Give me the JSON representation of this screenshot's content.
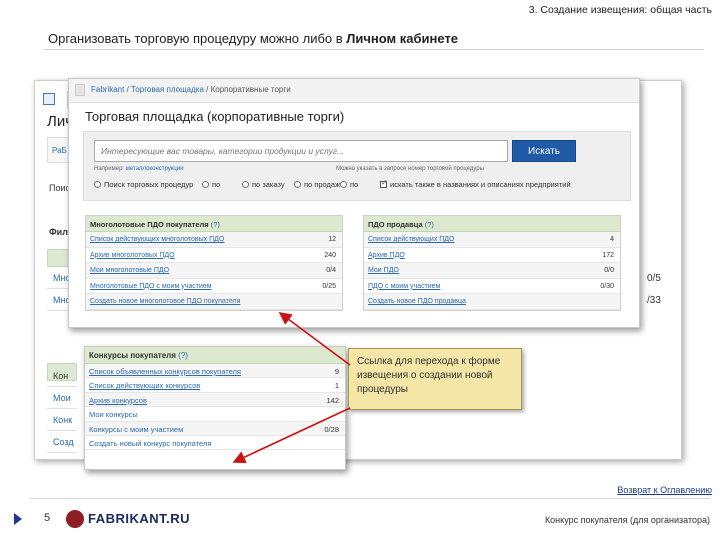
{
  "section_label": "3. Создание извещения: общая часть",
  "heading": {
    "prefix": "Организовать торговую процедуру можно либо в ",
    "bold": "Личном кабинете"
  },
  "bg_page": {
    "title": "Лич",
    "tab": "РаБ",
    "text1": "Поиско",
    "text2": "Филь",
    "rows": [
      "Мно",
      "Мно"
    ],
    "row_labels2": [
      "Кон",
      "Мои",
      "Конк",
      "Созд"
    ],
    "right_vals": [
      "0/5",
      "/33"
    ]
  },
  "window": {
    "breadcrumb": {
      "items": [
        "Fabrikant",
        "Торговая площадка",
        "Корпоративные торги"
      ],
      "separator": " / "
    },
    "title": "Торговая площадка (корпоративные торги)",
    "search": {
      "placeholder": "Интересующие вас товары, категории продукции и услуг...",
      "button": "Искать",
      "hint_left_prefix": "Например: ",
      "hint_left_link": "металлоконструкции",
      "hint_right": "Можно указать в запросе номер торговой процедуры",
      "options": [
        {
          "label": "Поиск торговых процедур",
          "type": "radio"
        },
        {
          "label": "по",
          "type": "radio"
        },
        {
          "label": "по заказу",
          "type": "radio"
        },
        {
          "label": "по продаже",
          "type": "radio"
        },
        {
          "label": "по",
          "type": "radio"
        },
        {
          "label": "искать также в названиях и описаниях предприятий",
          "type": "check"
        }
      ]
    },
    "panel_left": {
      "title": "Многолотовые ПДО покупателя",
      "help": "(?)",
      "rows": [
        {
          "label": "Список действующих многолотовых ПДО",
          "value": "12"
        },
        {
          "label": "Архив многолотовых ПДО",
          "value": "240"
        },
        {
          "label": "Мои многолотовые ПДО",
          "value": "0/4"
        },
        {
          "label": "Многолотовые ПДО с моим участием",
          "value": "0/25"
        },
        {
          "label": "Создать новое многолотовое ПДО покупателя",
          "value": ""
        }
      ]
    },
    "panel_right": {
      "title": "ПДО продавца",
      "help": "(?)",
      "rows": [
        {
          "label": "Список действующих ПДО",
          "value": "4"
        },
        {
          "label": "Архив ПДО",
          "value": "172"
        },
        {
          "label": "Мои ПДО",
          "value": "0/0"
        },
        {
          "label": "ПДО с моим участием",
          "value": "0/30"
        },
        {
          "label": "Создать новое ПДО продавца",
          "value": ""
        }
      ]
    }
  },
  "window2": {
    "title": "Конкурсы покупателя",
    "help": "(?)",
    "rows": [
      {
        "label": "Список объявленных конкурсов покупателя",
        "value": "9"
      },
      {
        "label": "Список действующих конкурсов",
        "value": "1"
      },
      {
        "label": "Архив конкурсов",
        "value": "142"
      },
      {
        "label": "Мои конкурсы",
        "value": ""
      },
      {
        "label": "Конкурсы с моим участием",
        "value": "0/28"
      },
      {
        "label": "Создать новый конкурс покупателя",
        "value": ""
      }
    ]
  },
  "callout": "Ссылка для перехода к форме извещения о создании новой процедуры",
  "back_link": "Возврат к Оглавлению",
  "footer": {
    "page_number": "5",
    "brand": "FABRIKANT.RU",
    "caption": "Конкурс покупателя (для организатора)"
  },
  "colors": {
    "accent_blue": "#1f5aa6",
    "panel_header_green": "#dce9cf",
    "callout_yellow": "#f3e6a6",
    "arrow_red": "#cc1111"
  }
}
